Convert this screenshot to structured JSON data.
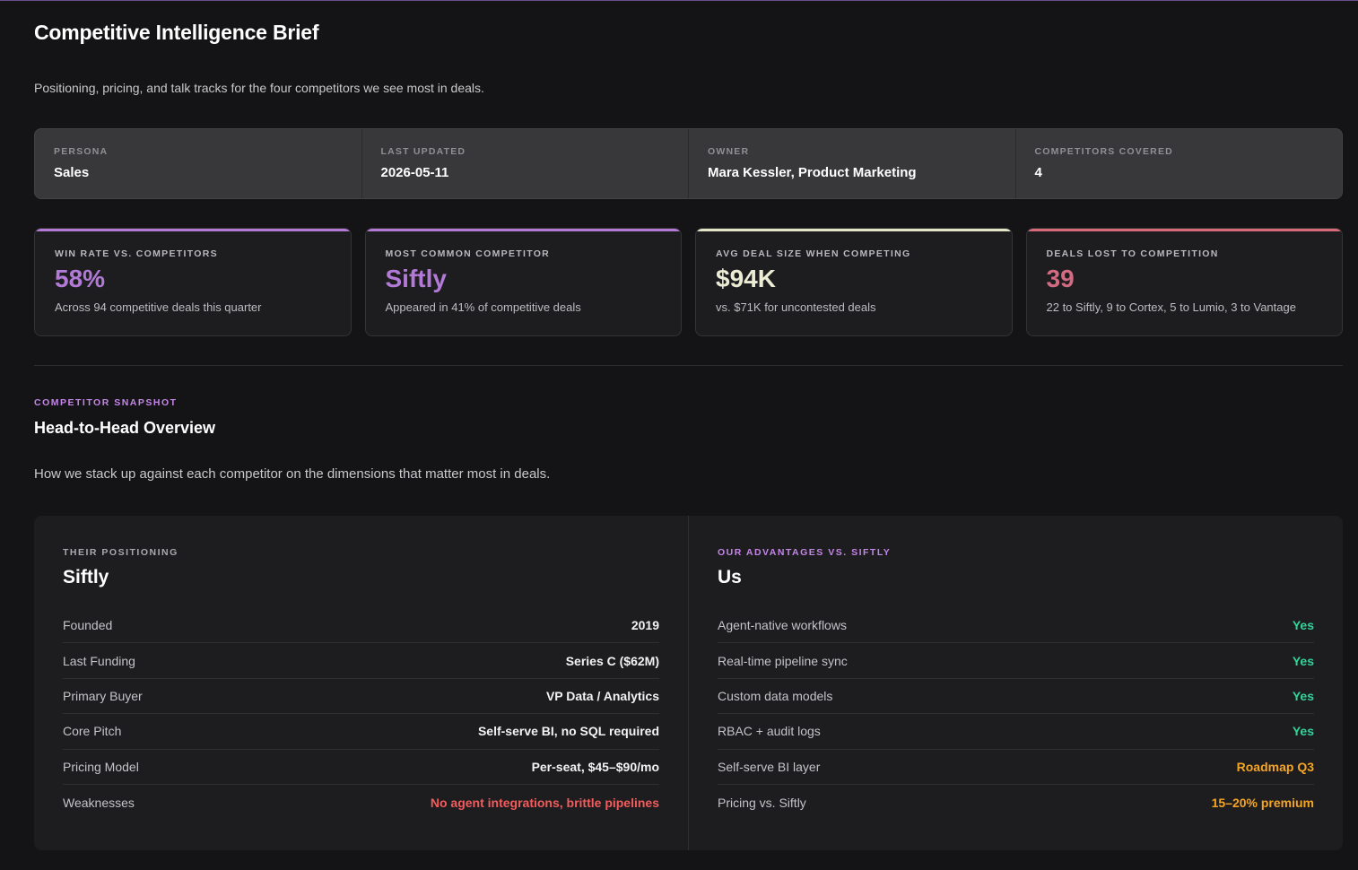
{
  "header": {
    "title": "Competitive Intelligence Brief",
    "subtitle": "Positioning, pricing, and talk tracks for the four competitors we see most in deals."
  },
  "meta": [
    {
      "label": "Persona",
      "value": "Sales"
    },
    {
      "label": "Last Updated",
      "value": "2026-05-11"
    },
    {
      "label": "Owner",
      "value": "Mara Kessler, Product Marketing"
    },
    {
      "label": "Competitors Covered",
      "value": "4"
    }
  ],
  "kpis": [
    {
      "label": "Win Rate vs. Competitors",
      "value": "58%",
      "sub": "Across 94 competitive deals this quarter",
      "accent": "#b27ad6",
      "value_color": "#b27ad6"
    },
    {
      "label": "Most Common Competitor",
      "value": "Siftly",
      "sub": "Appeared in 41% of competitive deals",
      "accent": "#b27ad6",
      "value_color": "#b27ad6"
    },
    {
      "label": "Avg Deal Size When Competing",
      "value": "$94K",
      "sub": "vs. $71K for uncontested deals",
      "accent": "#e3e3c6",
      "value_color": "#ececd4"
    },
    {
      "label": "Deals Lost to Competition",
      "value": "39",
      "sub": "22 to Siftly, 9 to Cortex, 5 to Lumio, 3 to Vantage",
      "accent": "#d8697a",
      "value_color": "#d26a82"
    }
  ],
  "section": {
    "eyebrow": "Competitor Snapshot",
    "title": "Head-to-Head Overview",
    "description": "How we stack up against each competitor on the dimensions that matter most in deals."
  },
  "compare": {
    "them": {
      "eyebrow": "Their Positioning",
      "eyebrow_color": "#a9a9ae",
      "title": "Siftly",
      "rows": [
        {
          "label": "Founded",
          "value": "2019",
          "color": "#f2f2f4"
        },
        {
          "label": "Last Funding",
          "value": "Series C ($62M)",
          "color": "#f2f2f4"
        },
        {
          "label": "Primary Buyer",
          "value": "VP Data / Analytics",
          "color": "#f2f2f4"
        },
        {
          "label": "Core Pitch",
          "value": "Self-serve BI, no SQL required",
          "color": "#f2f2f4"
        },
        {
          "label": "Pricing Model",
          "value": "Per-seat, $45–$90/mo",
          "color": "#f2f2f4"
        },
        {
          "label": "Weaknesses",
          "value": "No agent integrations, brittle pipelines",
          "color": "#f25c5c"
        }
      ]
    },
    "us": {
      "eyebrow": "Our Advantages vs. Siftly",
      "eyebrow_color": "#c586e8",
      "title": "Us",
      "rows": [
        {
          "label": "Agent-native workflows",
          "value": "Yes",
          "color": "#34d399"
        },
        {
          "label": "Real-time pipeline sync",
          "value": "Yes",
          "color": "#34d399"
        },
        {
          "label": "Custom data models",
          "value": "Yes",
          "color": "#34d399"
        },
        {
          "label": "RBAC + audit logs",
          "value": "Yes",
          "color": "#34d399"
        },
        {
          "label": "Self-serve BI layer",
          "value": "Roadmap Q3",
          "color": "#f5a524"
        },
        {
          "label": "Pricing vs. Siftly",
          "value": "15–20% premium",
          "color": "#f5a524"
        }
      ]
    }
  }
}
